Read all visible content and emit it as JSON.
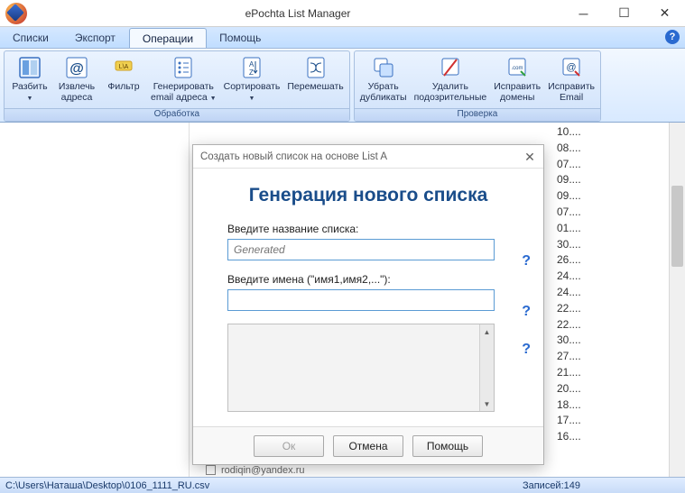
{
  "title": "ePochta List Manager",
  "menu": {
    "items": [
      "Списки",
      "Экспорт",
      "Операции",
      "Помощь"
    ],
    "active_index": 2
  },
  "ribbon": {
    "group1": {
      "caption": "Обработка",
      "buttons": [
        {
          "label": "Разбить",
          "has_arrow": true
        },
        {
          "label": "Извлечь\nадреса",
          "has_arrow": false
        },
        {
          "label": "Фильтр",
          "has_arrow": false
        },
        {
          "label": "Генерировать\nemail адреса",
          "has_arrow": true
        },
        {
          "label": "Сортировать",
          "has_arrow": true
        },
        {
          "label": "Перемешать",
          "has_arrow": false
        }
      ]
    },
    "group2": {
      "caption": "Проверка",
      "buttons": [
        {
          "label": "Убрать\nдубликаты",
          "has_arrow": false
        },
        {
          "label": "Удалить\nподозрительные",
          "has_arrow": false
        },
        {
          "label": "Исправить\nдомены",
          "has_arrow": false
        },
        {
          "label": "Исправить\nEmail",
          "has_arrow": false
        }
      ]
    }
  },
  "right_values": [
    "10....",
    "08....",
    "07....",
    "09....",
    "09....",
    "07....",
    "01....",
    "30....",
    "26....",
    "24....",
    "24....",
    "22....",
    "22....",
    "30....",
    "27....",
    "21....",
    "20....",
    "18....",
    "17....",
    "16...."
  ],
  "grid_peek": "rodiqin@yandex.ru",
  "dialog": {
    "title": "Создать новый список на основе List A",
    "heading": "Генерация нового списка",
    "label1": "Введите название списка:",
    "placeholder1": "Generated",
    "label2": "Введите имена (\"имя1,имя2,...\"):",
    "buttons": {
      "ok": "Ок",
      "cancel": "Отмена",
      "help": "Помощь"
    }
  },
  "status": {
    "path": "C:\\Users\\Наташа\\Desktop\\0106_1111_RU.csv",
    "records": "Записей:149"
  }
}
